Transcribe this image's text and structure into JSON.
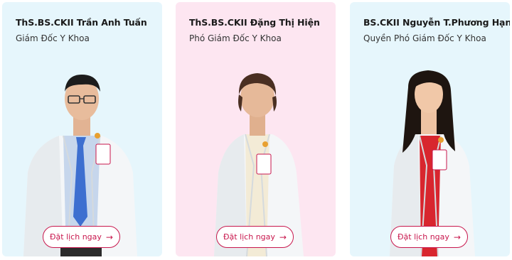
{
  "colors": {
    "card1_bg": "#e6f6fc",
    "card2_bg": "#fde6f1",
    "card3_bg": "#e6f6fc",
    "accent": "#c8174d"
  },
  "doctors": [
    {
      "name": "ThS.BS.CKII Trần Anh Tuấn",
      "role": "Giám Đốc Y Khoa",
      "button_label": "Đặt lịch ngay",
      "button_icon": "arrow-right-icon"
    },
    {
      "name": "ThS.BS.CKII Đặng Thị Hiện",
      "role": "Phó Giám Đốc Y Khoa",
      "button_label": "Đặt lịch ngay",
      "button_icon": "arrow-right-icon"
    },
    {
      "name": "BS.CKII Nguyễn T.Phương Hạnh",
      "role": "Quyền Phó Giám Đốc Y Khoa",
      "button_label": "Đặt lịch ngay",
      "button_icon": "arrow-right-icon"
    }
  ]
}
